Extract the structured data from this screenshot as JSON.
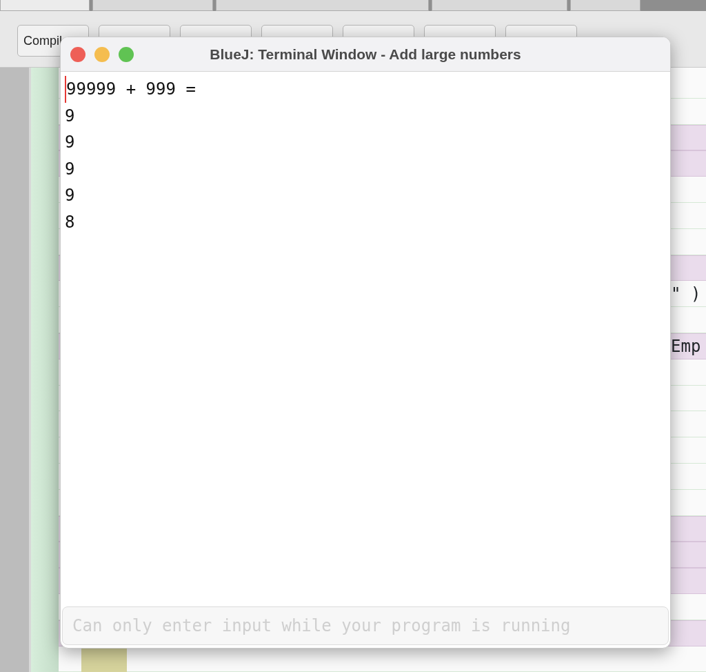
{
  "ide": {
    "tabs": [
      {
        "selected": true
      },
      {
        "selected": false
      },
      {
        "selected": false
      },
      {
        "selected": false
      },
      {
        "selected": false
      }
    ],
    "toolbar_buttons": [
      {
        "kind": "visible",
        "label": "Compil"
      },
      {
        "kind": "covered"
      },
      {
        "kind": "covered"
      },
      {
        "kind": "covered"
      },
      {
        "kind": "covered"
      },
      {
        "kind": "covered"
      },
      {
        "kind": "covered"
      }
    ],
    "editor_rows": [
      {
        "highlighted": false
      },
      {
        "highlighted": false
      },
      {
        "highlighted": true
      },
      {
        "highlighted": true
      },
      {
        "highlighted": false
      },
      {
        "highlighted": false
      },
      {
        "highlighted": false
      },
      {
        "highlighted": true
      },
      {
        "highlighted": false,
        "text": "\" )"
      },
      {
        "highlighted": false
      },
      {
        "highlighted": true,
        "text": "Emp"
      },
      {
        "highlighted": false
      },
      {
        "highlighted": false
      },
      {
        "highlighted": false
      },
      {
        "highlighted": false
      },
      {
        "highlighted": false
      },
      {
        "highlighted": false
      },
      {
        "highlighted": true
      },
      {
        "highlighted": true
      },
      {
        "highlighted": true
      },
      {
        "highlighted": false
      },
      {
        "highlighted": true
      },
      {
        "highlighted": false
      }
    ]
  },
  "terminal": {
    "title": "BlueJ: Terminal Window - Add large numbers",
    "output_lines": [
      "99999 + 999 =",
      "9",
      "9",
      "9",
      "9",
      "8"
    ],
    "input": {
      "placeholder": "Can only enter input while your program is running"
    }
  }
}
